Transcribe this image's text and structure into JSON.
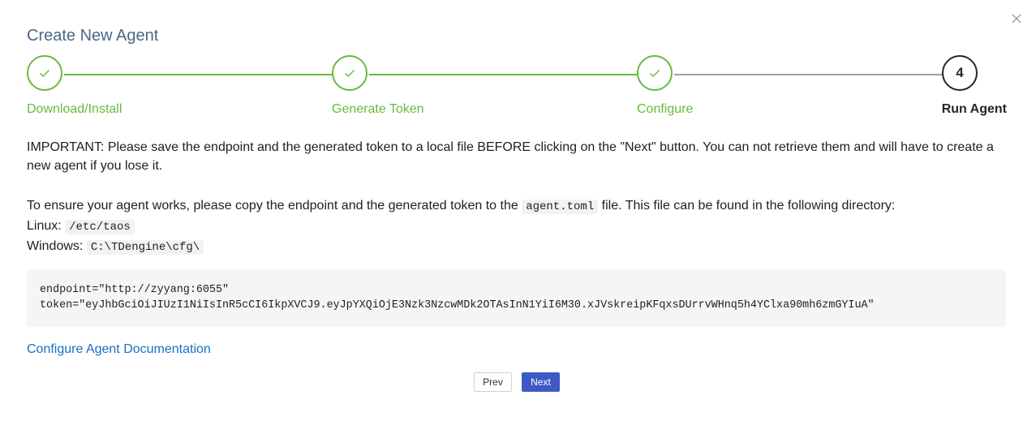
{
  "modal": {
    "title": "Create New Agent"
  },
  "steps": [
    {
      "label": "Download/Install",
      "status": "done"
    },
    {
      "label": "Generate Token",
      "status": "done"
    },
    {
      "label": "Configure",
      "status": "done"
    },
    {
      "label": "Run Agent",
      "status": "active",
      "number": "4"
    }
  ],
  "content": {
    "important": "IMPORTANT: Please save the endpoint and the generated token to a local file BEFORE clicking on the \"Next\" button. You can not retrieve them and will have to create a new agent if you lose it.",
    "copy_prefix": "To ensure your agent works, please copy the endpoint and the generated token to the",
    "config_file": "agent.toml",
    "copy_suffix": "file. This file can be found in the following directory:",
    "linux_label": "Linux:",
    "linux_path": "/etc/taos",
    "windows_label": "Windows:",
    "windows_path": "C:\\TDengine\\cfg\\",
    "code": "endpoint=\"http://zyyang:6055\"\ntoken=\"eyJhbGciOiJIUzI1NiIsInR5cCI6IkpXVCJ9.eyJpYXQiOjE3Nzk3NzcwMDk2OTAsInN1YiI6M30.xJVskreipKFqxsDUrrvWHnq5h4YClxa90mh6zmGYIuA\"",
    "doc_link": "Configure Agent Documentation"
  },
  "buttons": {
    "prev": "Prev",
    "next": "Next"
  },
  "colors": {
    "done": "#66bb3a",
    "primary": "#3f59c4",
    "link": "#1a6fc4"
  }
}
